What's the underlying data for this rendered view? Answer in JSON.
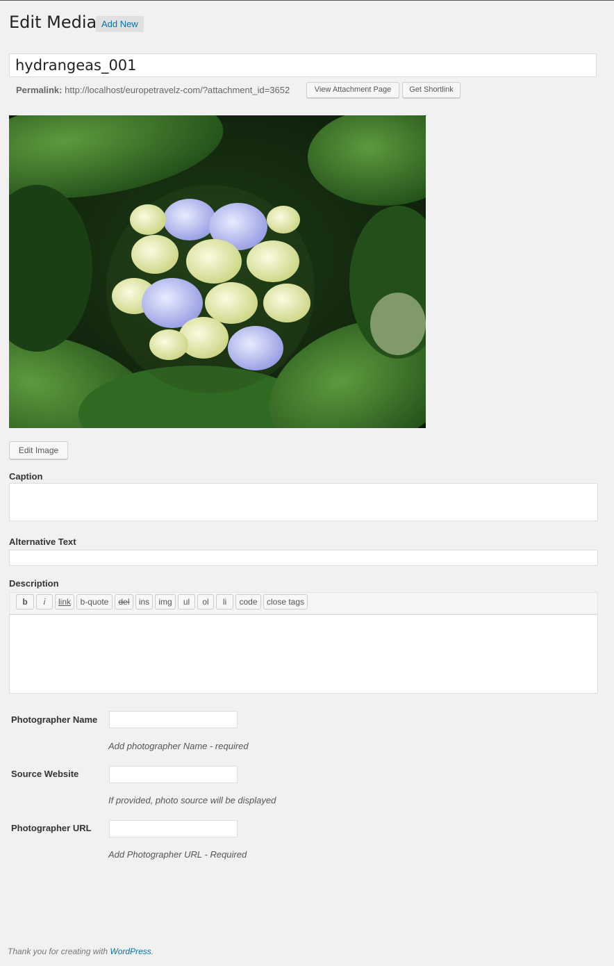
{
  "header": {
    "title": "Edit Media",
    "add_new_label": "Add New"
  },
  "post_title": {
    "value": "hydrangeas_001"
  },
  "permalink": {
    "label": "Permalink:",
    "url": "http://localhost/europetravelz-com/?attachment_id=3652",
    "view_button": "View Attachment Page",
    "shortlink_button": "Get Shortlink"
  },
  "image": {
    "alt": "Blue and cream hydrangea flower among green leaves"
  },
  "edit_image_label": "Edit Image",
  "caption": {
    "label": "Caption",
    "value": ""
  },
  "alt_text": {
    "label": "Alternative Text",
    "value": ""
  },
  "description": {
    "label": "Description",
    "toolbar": [
      "b",
      "i",
      "link",
      "b-quote",
      "del",
      "ins",
      "img",
      "ul",
      "ol",
      "li",
      "code",
      "close tags"
    ],
    "value": ""
  },
  "fields": {
    "photographer_name": {
      "label": "Photographer Name",
      "value": "",
      "help": "Add photographer Name - required"
    },
    "source_website": {
      "label": "Source Website",
      "value": "",
      "help": "If provided, photo source will be displayed"
    },
    "photographer_url": {
      "label": "Photographer URL",
      "value": "",
      "help": "Add Photographer URL - Required"
    }
  },
  "footer": {
    "text": "Thank you for creating with",
    "link": "WordPress",
    "trailing": "."
  },
  "colors": {
    "link": "#0073aa",
    "background": "#f1f1f1"
  }
}
